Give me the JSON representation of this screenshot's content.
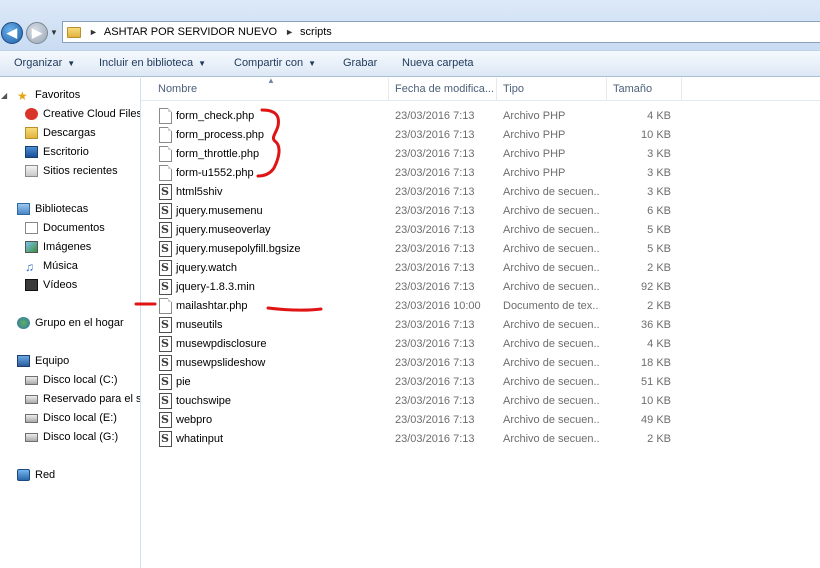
{
  "address_bar": {
    "path": [
      "ASHTAR POR SERVIDOR NUEVO",
      "scripts"
    ]
  },
  "toolbar": {
    "organize": "Organizar",
    "include_library": "Incluir en biblioteca",
    "share_with": "Compartir con",
    "burn": "Grabar",
    "new_folder": "Nueva carpeta"
  },
  "nav": {
    "favorites": {
      "label": "Favoritos",
      "items": [
        "Creative Cloud Files",
        "Descargas",
        "Escritorio",
        "Sitios recientes"
      ]
    },
    "libraries": {
      "label": "Bibliotecas",
      "items": [
        "Documentos",
        "Imágenes",
        "Música",
        "Vídeos"
      ]
    },
    "homegroup": {
      "label": "Grupo en el hogar"
    },
    "computer": {
      "label": "Equipo",
      "items": [
        "Disco local (C:)",
        "Reservado para el sistema",
        "Disco local (E:)",
        "Disco local (G:)"
      ]
    },
    "network": {
      "label": "Red"
    }
  },
  "columns": {
    "name": "Nombre",
    "date": "Fecha de modifica...",
    "type": "Tipo",
    "size": "Tamaño"
  },
  "files": [
    {
      "name": "form_check.php",
      "date": "23/03/2016 7:13",
      "type": "Archivo PHP",
      "size": "4 KB",
      "icon": "php-file-icon"
    },
    {
      "name": "form_process.php",
      "date": "23/03/2016 7:13",
      "type": "Archivo PHP",
      "size": "10 KB",
      "icon": "php-file-icon"
    },
    {
      "name": "form_throttle.php",
      "date": "23/03/2016 7:13",
      "type": "Archivo PHP",
      "size": "3 KB",
      "icon": "php-file-icon"
    },
    {
      "name": "form-u1552.php",
      "date": "23/03/2016 7:13",
      "type": "Archivo PHP",
      "size": "3 KB",
      "icon": "php-file-icon"
    },
    {
      "name": "html5shiv",
      "date": "23/03/2016 7:13",
      "type": "Archivo de secuen...",
      "size": "3 KB",
      "icon": "script-file-icon"
    },
    {
      "name": "jquery.musemenu",
      "date": "23/03/2016 7:13",
      "type": "Archivo de secuen...",
      "size": "6 KB",
      "icon": "script-file-icon"
    },
    {
      "name": "jquery.museoverlay",
      "date": "23/03/2016 7:13",
      "type": "Archivo de secuen...",
      "size": "5 KB",
      "icon": "script-file-icon"
    },
    {
      "name": "jquery.musepolyfill.bgsize",
      "date": "23/03/2016 7:13",
      "type": "Archivo de secuen...",
      "size": "5 KB",
      "icon": "script-file-icon"
    },
    {
      "name": "jquery.watch",
      "date": "23/03/2016 7:13",
      "type": "Archivo de secuen...",
      "size": "2 KB",
      "icon": "script-file-icon"
    },
    {
      "name": "jquery-1.8.3.min",
      "date": "23/03/2016 7:13",
      "type": "Archivo de secuen...",
      "size": "92 KB",
      "icon": "script-file-icon"
    },
    {
      "name": "mailashtar.php",
      "date": "23/03/2016 10:00",
      "type": "Documento de tex...",
      "size": "2 KB",
      "icon": "text-file-icon"
    },
    {
      "name": "museutils",
      "date": "23/03/2016 7:13",
      "type": "Archivo de secuen...",
      "size": "36 KB",
      "icon": "script-file-icon"
    },
    {
      "name": "musewpdisclosure",
      "date": "23/03/2016 7:13",
      "type": "Archivo de secuen...",
      "size": "4 KB",
      "icon": "script-file-icon"
    },
    {
      "name": "musewpslideshow",
      "date": "23/03/2016 7:13",
      "type": "Archivo de secuen...",
      "size": "18 KB",
      "icon": "script-file-icon"
    },
    {
      "name": "pie",
      "date": "23/03/2016 7:13",
      "type": "Archivo de secuen...",
      "size": "51 KB",
      "icon": "script-file-icon"
    },
    {
      "name": "touchswipe",
      "date": "23/03/2016 7:13",
      "type": "Archivo de secuen...",
      "size": "10 KB",
      "icon": "script-file-icon"
    },
    {
      "name": "webpro",
      "date": "23/03/2016 7:13",
      "type": "Archivo de secuen...",
      "size": "49 KB",
      "icon": "script-file-icon"
    },
    {
      "name": "whatinput",
      "date": "23/03/2016 7:13",
      "type": "Archivo de secuen...",
      "size": "2 KB",
      "icon": "script-file-icon"
    }
  ]
}
